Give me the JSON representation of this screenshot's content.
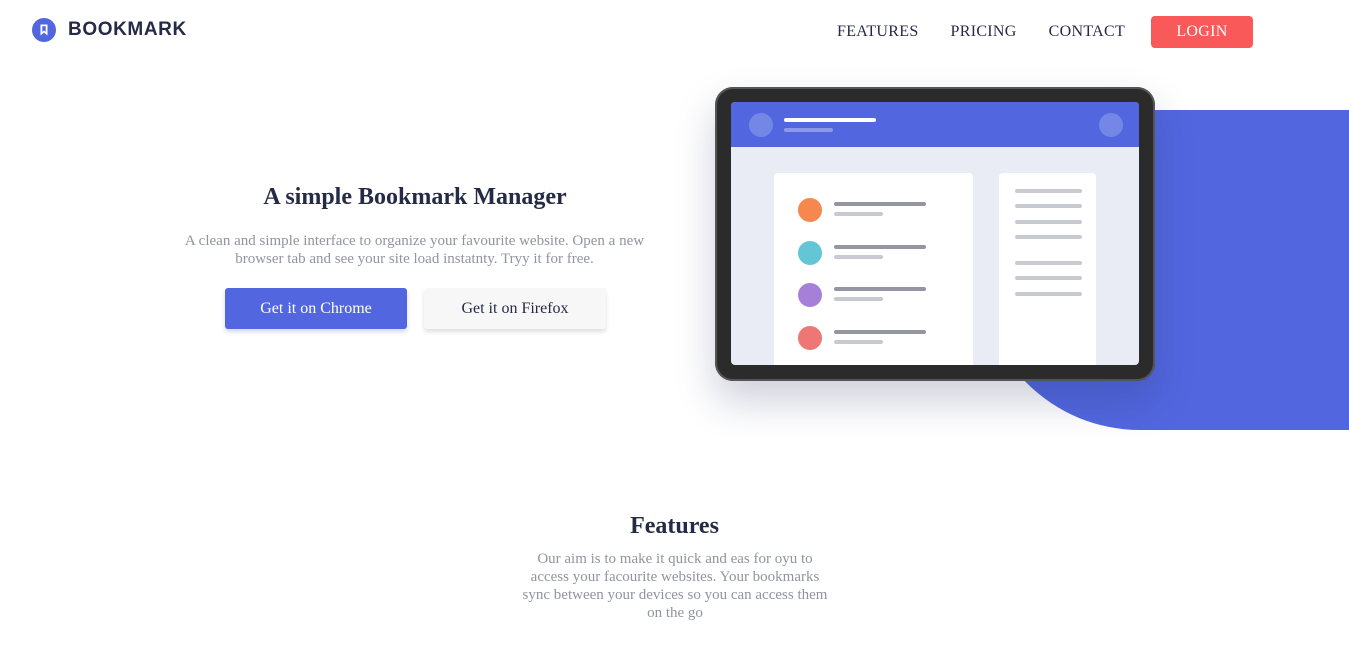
{
  "header": {
    "logo_text": "BOOKMARK",
    "nav": [
      "FEATURES",
      "PRICING",
      "CONTACT"
    ],
    "login_label": "LOGIN"
  },
  "hero": {
    "title": "A simple Bookmark Manager",
    "description": "A clean and simple interface to organize your favourite website. Open a new browser tab and see your site load instatnty. Tryy it for free.",
    "chrome_button": "Get it on Chrome",
    "firefox_button": "Get it on Firefox"
  },
  "features": {
    "title": "Features",
    "description": "Our aim is to make it quick and eas for oyu to access your facourite websites. Your bookmarks sync between your devices so you can access them on the go"
  },
  "colors": {
    "accent": "#5267DF",
    "login": "#FA5959",
    "dark": "#252B46",
    "muted": "#9194A1"
  },
  "icons": {
    "logo": "bookmark-icon"
  }
}
